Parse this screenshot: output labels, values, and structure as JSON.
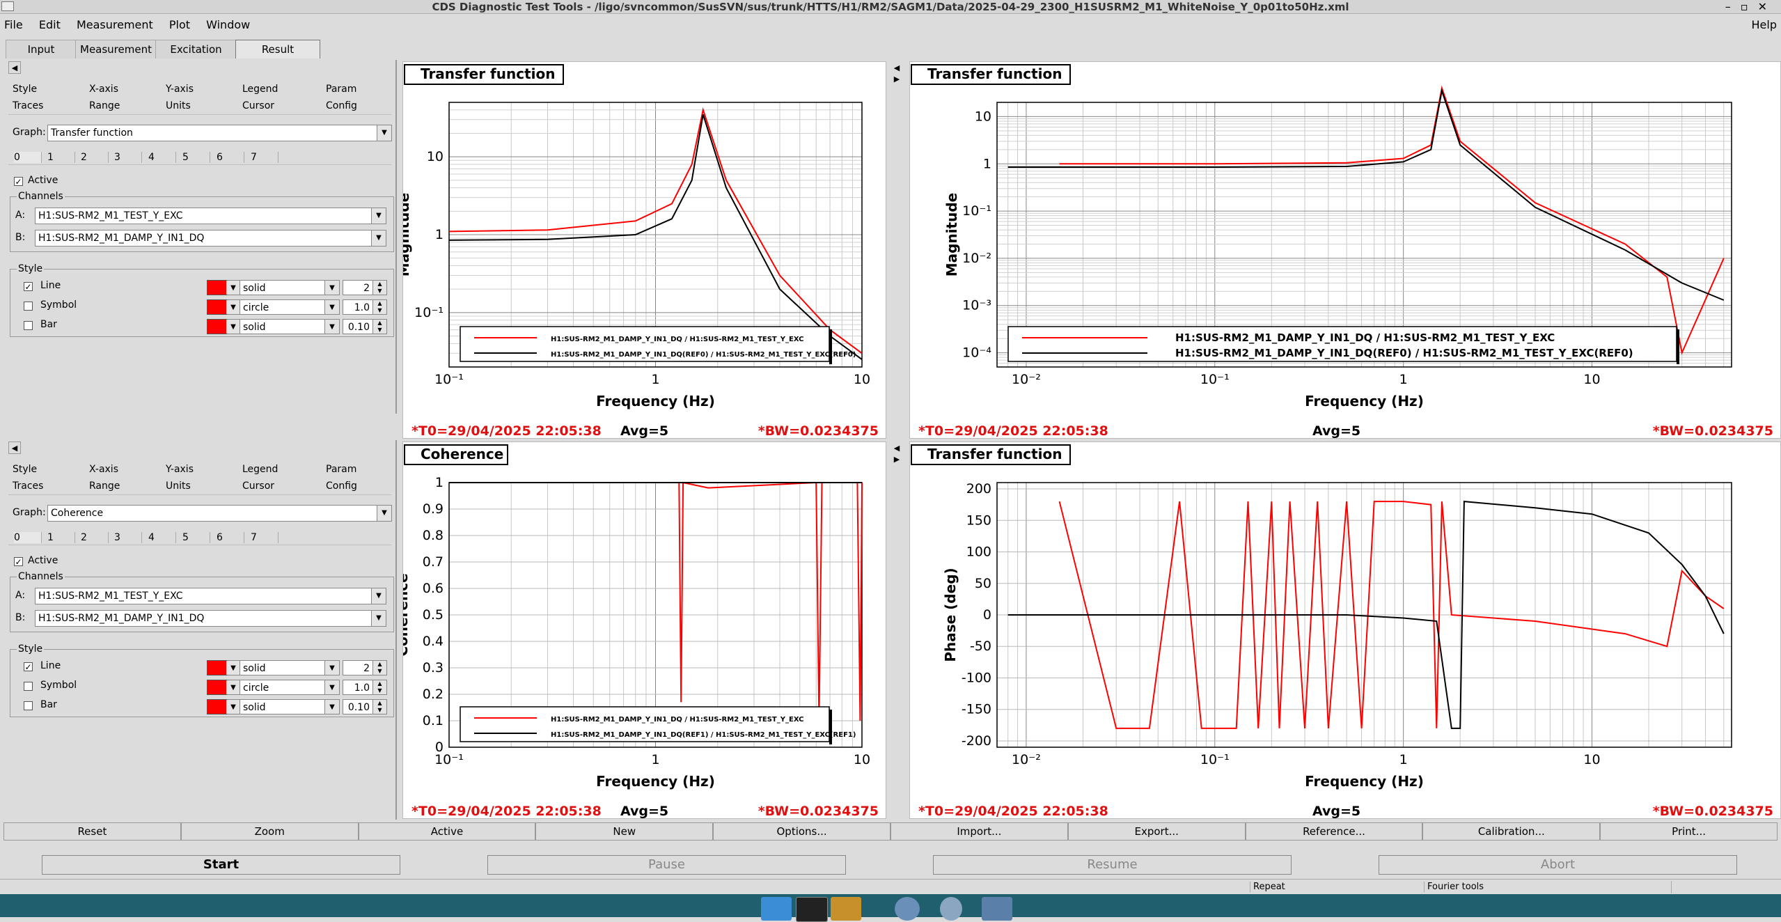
{
  "window": {
    "title": "CDS Diagnostic Test Tools - /ligo/svncommon/SusSVN/sus/trunk/HTTS/H1/RM2/SAGM1/Data/2025-04-29_2300_H1SUSRM2_M1_WhiteNoise_Y_0p01to50Hz.xml"
  },
  "menu": {
    "file": "File",
    "edit": "Edit",
    "measurement": "Measurement",
    "plot": "Plot",
    "window": "Window",
    "help": "Help"
  },
  "main_tabs": [
    "Input",
    "Measurement",
    "Excitation",
    "Result"
  ],
  "panels": [
    {
      "subtabs_row1": [
        "Style",
        "X-axis",
        "Y-axis",
        "Legend",
        "Param"
      ],
      "subtabs_row2": [
        "Traces",
        "Range",
        "Units",
        "Cursor",
        "Config"
      ],
      "graph_label": "Graph:",
      "graph_value": "Transfer function",
      "trace_tabs": [
        "0",
        "1",
        "2",
        "3",
        "4",
        "5",
        "6",
        "7"
      ],
      "active_label": "Active",
      "channels_label": "Channels",
      "chan_a_label": "A:",
      "chan_a": "H1:SUS-RM2_M1_TEST_Y_EXC",
      "chan_b_label": "B:",
      "chan_b": "H1:SUS-RM2_M1_DAMP_Y_IN1_DQ",
      "style_label": "Style",
      "line_label": "Line",
      "line_style": "solid",
      "line_width": "2",
      "symbol_label": "Symbol",
      "symbol_style": "circle",
      "symbol_size": "1.0",
      "bar_label": "Bar",
      "bar_style": "solid",
      "bar_width": "0.10"
    },
    {
      "subtabs_row1": [
        "Style",
        "X-axis",
        "Y-axis",
        "Legend",
        "Param"
      ],
      "subtabs_row2": [
        "Traces",
        "Range",
        "Units",
        "Cursor",
        "Config"
      ],
      "graph_label": "Graph:",
      "graph_value": "Coherence",
      "trace_tabs": [
        "0",
        "1",
        "2",
        "3",
        "4",
        "5",
        "6",
        "7"
      ],
      "active_label": "Active",
      "channels_label": "Channels",
      "chan_a_label": "A:",
      "chan_a": "H1:SUS-RM2_M1_TEST_Y_EXC",
      "chan_b_label": "B:",
      "chan_b": "H1:SUS-RM2_M1_DAMP_Y_IN1_DQ",
      "style_label": "Style",
      "line_label": "Line",
      "line_style": "solid",
      "line_width": "2",
      "symbol_label": "Symbol",
      "symbol_style": "circle",
      "symbol_size": "1.0",
      "bar_label": "Bar",
      "bar_style": "solid",
      "bar_width": "0.10"
    }
  ],
  "plots": [
    {
      "title": "Transfer function",
      "ylabel": "Magnitude",
      "xlabel": "Frequency (Hz)",
      "xticks": [
        "10⁻¹",
        "1",
        "10"
      ],
      "yticks": [
        "10",
        "1",
        "10⁻¹"
      ],
      "legend": [
        "H1:SUS-RM2_M1_DAMP_Y_IN1_DQ / H1:SUS-RM2_M1_TEST_Y_EXC",
        "H1:SUS-RM2_M1_DAMP_Y_IN1_DQ(REF0) / H1:SUS-RM2_M1_TEST_Y_EXC(REF0)"
      ],
      "t0": "*T0=29/04/2025 22:05:38",
      "avg": "Avg=5",
      "bw": "*BW=0.0234375"
    },
    {
      "title": "Transfer function",
      "ylabel": "Magnitude",
      "xlabel": "Frequency (Hz)",
      "xticks": [
        "10⁻²",
        "10⁻¹",
        "1",
        "10"
      ],
      "yticks": [
        "10",
        "1",
        "10⁻¹",
        "10⁻²",
        "10⁻³",
        "10⁻⁴"
      ],
      "legend": [
        "H1:SUS-RM2_M1_DAMP_Y_IN1_DQ / H1:SUS-RM2_M1_TEST_Y_EXC",
        "H1:SUS-RM2_M1_DAMP_Y_IN1_DQ(REF0) / H1:SUS-RM2_M1_TEST_Y_EXC(REF0)"
      ],
      "t0": "*T0=29/04/2025 22:05:38",
      "avg": "Avg=5",
      "bw": "*BW=0.0234375"
    },
    {
      "title": "Coherence",
      "ylabel": "Coherence",
      "xlabel": "Frequency (Hz)",
      "xticks": [
        "10⁻¹",
        "1",
        "10"
      ],
      "yticks": [
        "1",
        "0.9",
        "0.8",
        "0.7",
        "0.6",
        "0.5",
        "0.4",
        "0.3",
        "0.2",
        "0.1",
        "0"
      ],
      "legend": [
        "H1:SUS-RM2_M1_DAMP_Y_IN1_DQ / H1:SUS-RM2_M1_TEST_Y_EXC",
        "H1:SUS-RM2_M1_DAMP_Y_IN1_DQ(REF1) / H1:SUS-RM2_M1_TEST_Y_EXC(REF1)"
      ],
      "t0": "*T0=29/04/2025 22:05:38",
      "avg": "Avg=5",
      "bw": "*BW=0.0234375"
    },
    {
      "title": "Transfer function",
      "ylabel": "Phase (deg)",
      "xlabel": "Frequency (Hz)",
      "xticks": [
        "10⁻²",
        "10⁻¹",
        "1",
        "10"
      ],
      "yticks": [
        "200",
        "150",
        "100",
        "50",
        "0",
        "-50",
        "-100",
        "-150",
        "-200"
      ],
      "t0": "*T0=29/04/2025 22:05:38",
      "avg": "Avg=5",
      "bw": "*BW=0.0234375"
    }
  ],
  "chart_data": [
    {
      "type": "line",
      "title": "Transfer function",
      "xlabel": "Frequency (Hz)",
      "ylabel": "Magnitude",
      "xscale": "log",
      "yscale": "log",
      "xlim": [
        0.1,
        10
      ],
      "ylim": [
        0.02,
        50
      ],
      "series": [
        {
          "name": "H1:SUS-RM2_M1_DAMP_Y_IN1_DQ / H1:SUS-RM2_M1_TEST_Y_EXC",
          "color": "#ff0000",
          "x": [
            0.1,
            0.3,
            0.8,
            1.2,
            1.5,
            1.7,
            2.2,
            4,
            7,
            10
          ],
          "y": [
            1.1,
            1.15,
            1.5,
            2.5,
            8,
            40,
            5,
            0.3,
            0.06,
            0.03
          ]
        },
        {
          "name": "H1:SUS-RM2_M1_DAMP_Y_IN1_DQ(REF0) / H1:SUS-RM2_M1_TEST_Y_EXC(REF0)",
          "color": "#000000",
          "x": [
            0.1,
            0.3,
            0.8,
            1.2,
            1.5,
            1.7,
            2.2,
            4,
            7,
            10
          ],
          "y": [
            0.85,
            0.87,
            1.0,
            1.6,
            5,
            35,
            4,
            0.2,
            0.05,
            0.025
          ]
        }
      ]
    },
    {
      "type": "line",
      "title": "Transfer function",
      "xlabel": "Frequency (Hz)",
      "ylabel": "Magnitude",
      "xscale": "log",
      "yscale": "log",
      "xlim": [
        0.007,
        55
      ],
      "ylim": [
        5e-05,
        20
      ],
      "series": [
        {
          "name": "H1:SUS-RM2_M1_DAMP_Y_IN1_DQ / H1:SUS-RM2_M1_TEST_Y_EXC",
          "color": "#ff0000",
          "x": [
            0.015,
            0.1,
            0.5,
            1.0,
            1.4,
            1.6,
            2.0,
            5,
            15,
            25,
            30,
            50
          ],
          "y": [
            1.0,
            1.0,
            1.05,
            1.3,
            2.5,
            40,
            3,
            0.15,
            0.02,
            0.004,
            0.0001,
            0.01
          ]
        },
        {
          "name": "H1:SUS-RM2_M1_DAMP_Y_IN1_DQ(REF0) / H1:SUS-RM2_M1_TEST_Y_EXC(REF0)",
          "color": "#000000",
          "x": [
            0.008,
            0.1,
            0.5,
            1.0,
            1.4,
            1.6,
            2.0,
            5,
            15,
            30,
            50
          ],
          "y": [
            0.85,
            0.85,
            0.88,
            1.1,
            2.0,
            35,
            2.5,
            0.12,
            0.015,
            0.003,
            0.0013
          ]
        }
      ]
    },
    {
      "type": "line",
      "title": "Coherence",
      "xlabel": "Frequency (Hz)",
      "ylabel": "Coherence",
      "xscale": "log",
      "xlim": [
        0.1,
        10
      ],
      "ylim": [
        0,
        1
      ],
      "series": [
        {
          "name": "H1:SUS-RM2_M1_DAMP_Y_IN1_DQ / H1:SUS-RM2_M1_TEST_Y_EXC",
          "color": "#ff0000",
          "x": [
            0.1,
            1.3,
            1.33,
            1.36,
            1.8,
            6.0,
            6.2,
            6.4,
            9.5,
            9.8,
            10
          ],
          "y": [
            1,
            1,
            0.17,
            1,
            0.98,
            1,
            0.1,
            1,
            1,
            0.1,
            1
          ]
        },
        {
          "name": "H1:SUS-RM2_M1_DAMP_Y_IN1_DQ(REF1) / H1:SUS-RM2_M1_TEST_Y_EXC(REF1)",
          "color": "#000000",
          "x": [
            0.1,
            1.5,
            6,
            10
          ],
          "y": [
            1,
            1,
            1,
            1
          ]
        }
      ]
    },
    {
      "type": "line",
      "title": "Transfer function",
      "xlabel": "Frequency (Hz)",
      "ylabel": "Phase (deg)",
      "xscale": "log",
      "xlim": [
        0.007,
        55
      ],
      "ylim": [
        -210,
        210
      ],
      "series": [
        {
          "name": "red trace",
          "color": "#ff0000",
          "x": [
            0.015,
            0.03,
            0.045,
            0.065,
            0.085,
            0.13,
            0.15,
            0.17,
            0.2,
            0.22,
            0.25,
            0.3,
            0.35,
            0.4,
            0.5,
            0.6,
            0.7,
            1.0,
            1.4,
            1.5,
            1.6,
            1.8,
            5,
            15,
            25,
            30,
            40,
            50
          ],
          "y": [
            180,
            -180,
            -180,
            180,
            -180,
            -180,
            180,
            -180,
            180,
            -180,
            180,
            -180,
            180,
            -180,
            180,
            -180,
            180,
            180,
            175,
            -180,
            180,
            0,
            -10,
            -30,
            -50,
            70,
            30,
            10
          ]
        },
        {
          "name": "black trace",
          "color": "#000000",
          "x": [
            0.008,
            0.1,
            0.5,
            1.0,
            1.5,
            1.8,
            2.0,
            2.1,
            5,
            10,
            20,
            30,
            40,
            50
          ],
          "y": [
            0,
            0,
            0,
            -5,
            -10,
            -180,
            -180,
            180,
            170,
            160,
            130,
            80,
            30,
            -30
          ]
        }
      ]
    }
  ],
  "buttons": [
    "Reset",
    "Zoom",
    "Active",
    "New",
    "Options...",
    "Import...",
    "Export...",
    "Reference...",
    "Calibration...",
    "Print..."
  ],
  "controls": {
    "start": "Start",
    "pause": "Pause",
    "resume": "Resume",
    "abort": "Abort"
  },
  "status": {
    "repeat": "Repeat",
    "fourier": "Fourier tools"
  }
}
